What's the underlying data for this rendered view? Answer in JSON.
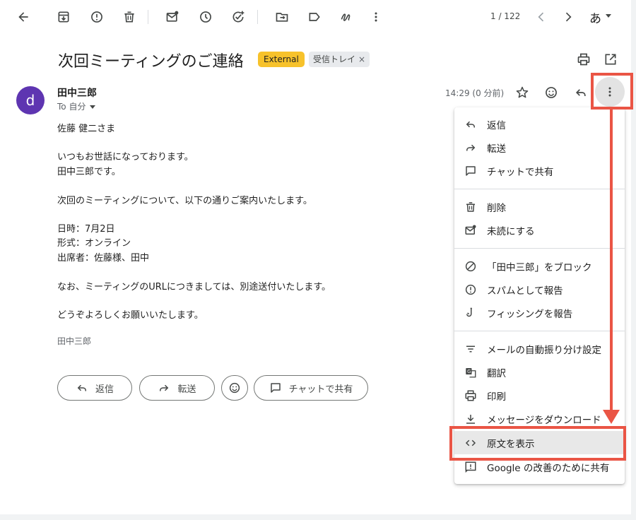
{
  "toolbar": {
    "icons": [
      "back-arrow-icon",
      "archive-icon",
      "report-icon",
      "delete-icon",
      "mark-unread-icon",
      "snooze-icon",
      "add-task-icon",
      "move-to-icon",
      "label-icon",
      "more-apps-icon",
      "more-vert-icon"
    ],
    "pager": "1 / 122",
    "input_method": "あ"
  },
  "email": {
    "subject": "次回ミーティングのご連絡",
    "badge_external": "External",
    "badge_inbox": "受信トレイ",
    "badge_inbox_close": "×",
    "sender_initial": "d",
    "sender_name": "田中三郎",
    "to": "To 自分",
    "time": "14:29 (0 分前)",
    "body": [
      "佐藤 健二さま",
      "いつもお世話になっております。",
      "田中三郎です。",
      "次回のミーティングについて、以下の通りご案内いたします。",
      "日時：7月2日",
      "形式：オンライン",
      "出席者：佐藤様、田中",
      "なお、ミーティングのURLにつきましては、別途送付いたします。",
      "どうぞよろしくお願いいたします。"
    ],
    "signature": "田中三郎"
  },
  "actions": {
    "reply": "返信",
    "forward": "転送",
    "chat_share": "チャットで共有"
  },
  "menu": {
    "items": [
      {
        "label": "返信",
        "icon": "reply-icon"
      },
      {
        "label": "転送",
        "icon": "forward-icon"
      },
      {
        "label": "チャットで共有",
        "icon": "chat-icon"
      },
      {
        "label": "削除",
        "icon": "delete-icon"
      },
      {
        "label": "未読にする",
        "icon": "mark-unread-icon"
      },
      {
        "label": "「田中三郎」をブロック",
        "icon": "block-icon"
      },
      {
        "label": "スパムとして報告",
        "icon": "report-spam-icon"
      },
      {
        "label": "フィッシングを報告",
        "icon": "phishing-icon"
      },
      {
        "label": "メールの自動振り分け設定",
        "icon": "filter-icon"
      },
      {
        "label": "翻訳",
        "icon": "translate-icon"
      },
      {
        "label": "印刷",
        "icon": "print-icon"
      },
      {
        "label": "メッセージをダウンロード",
        "icon": "download-icon"
      },
      {
        "label": "原文を表示",
        "icon": "code-icon"
      },
      {
        "label": "Google の改善のために共有",
        "icon": "feedback-icon"
      }
    ]
  },
  "colors": {
    "accent_annotation": "#ea5545",
    "badge_external": "#f7c22b",
    "avatar": "#5e35b1"
  }
}
